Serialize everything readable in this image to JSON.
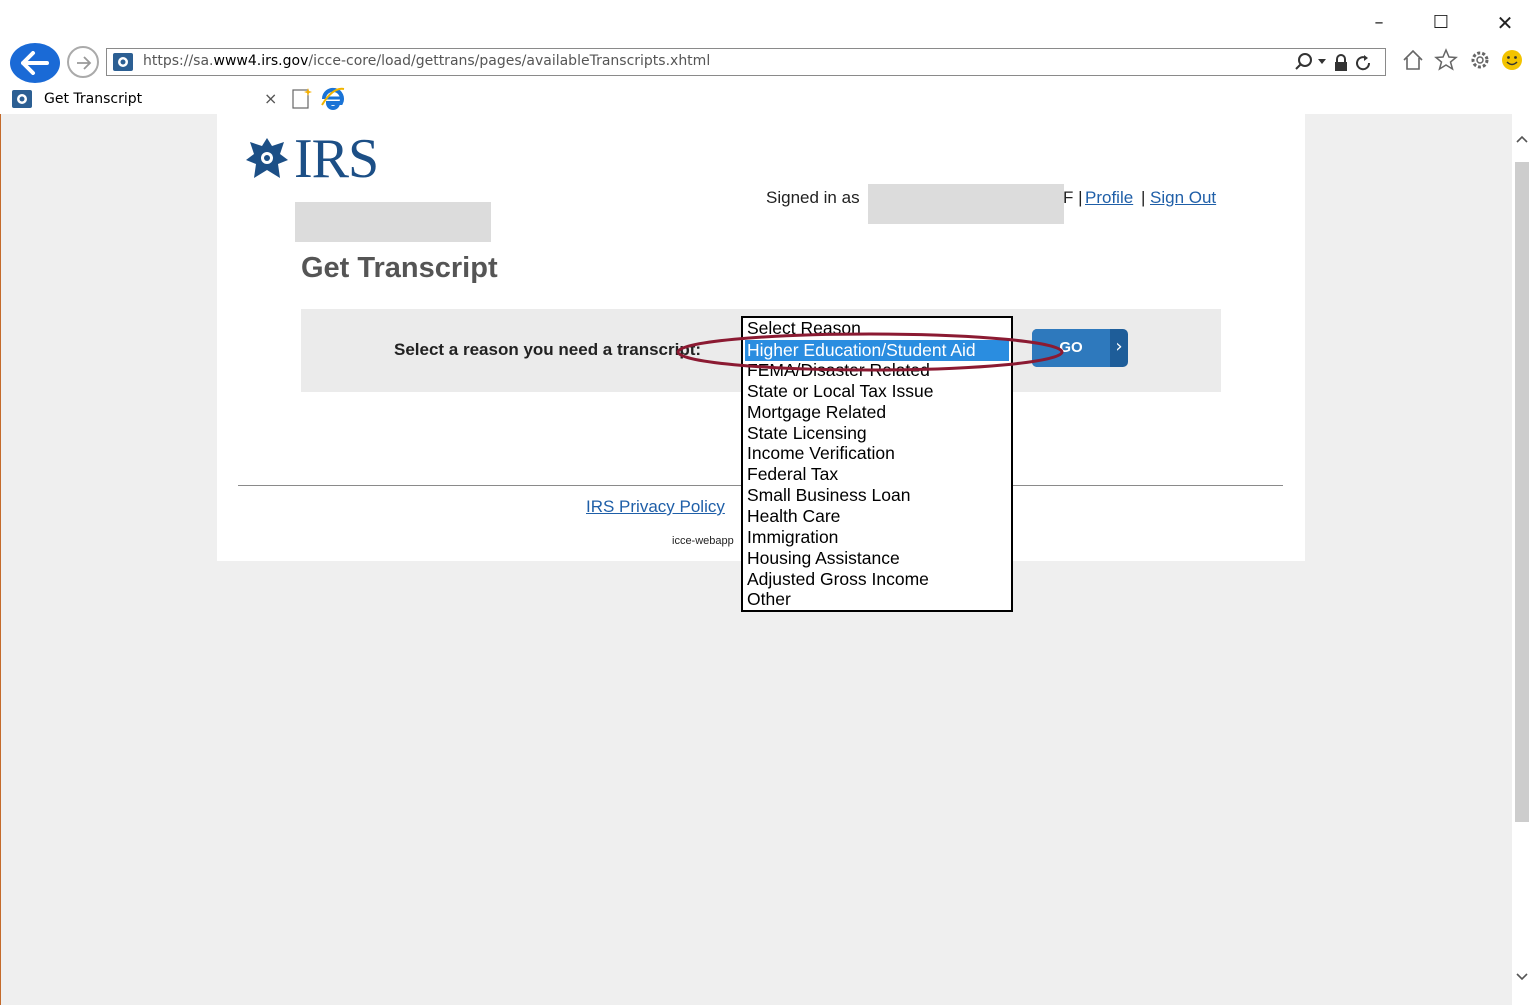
{
  "browser": {
    "url_prefix": "https://sa.",
    "url_domain": "www4.irs.gov",
    "url_path": "/icce-core/load/gettrans/pages/availableTranscripts.xhtml",
    "window_controls": {
      "minimize": "–",
      "maximize": "☐",
      "close": "✕"
    },
    "tab": {
      "title": "Get Transcript",
      "close": "×"
    }
  },
  "header": {
    "logo_text": "IRS",
    "signed_in_label": "Signed in as",
    "user_tail": "F |",
    "profile_link": "Profile",
    "separator": "|",
    "sign_out_link": "Sign Out"
  },
  "main": {
    "title": "Get Transcript",
    "reason_label": "Select a reason you need a transcript:",
    "go_button": "GO",
    "go_chevron": "›"
  },
  "reason_options": [
    "Select Reason",
    "Higher Education/Student Aid",
    "FEMA/Disaster Related",
    "State or Local Tax Issue",
    "Mortgage Related",
    "State Licensing",
    "Income Verification",
    "Federal Tax",
    "Small Business Loan",
    "Health Care",
    "Immigration",
    "Housing Assistance",
    "Adjusted Gross Income",
    "Other"
  ],
  "selected_option": "Higher Education/Student Aid",
  "footer": {
    "privacy_link": "IRS Privacy Policy",
    "build_text": "icce-webapp"
  },
  "colors": {
    "link": "#1f5fa8",
    "go_button": "#2e79bd",
    "selected_option": "#2a8de0",
    "annotation": "#8b1a32"
  }
}
